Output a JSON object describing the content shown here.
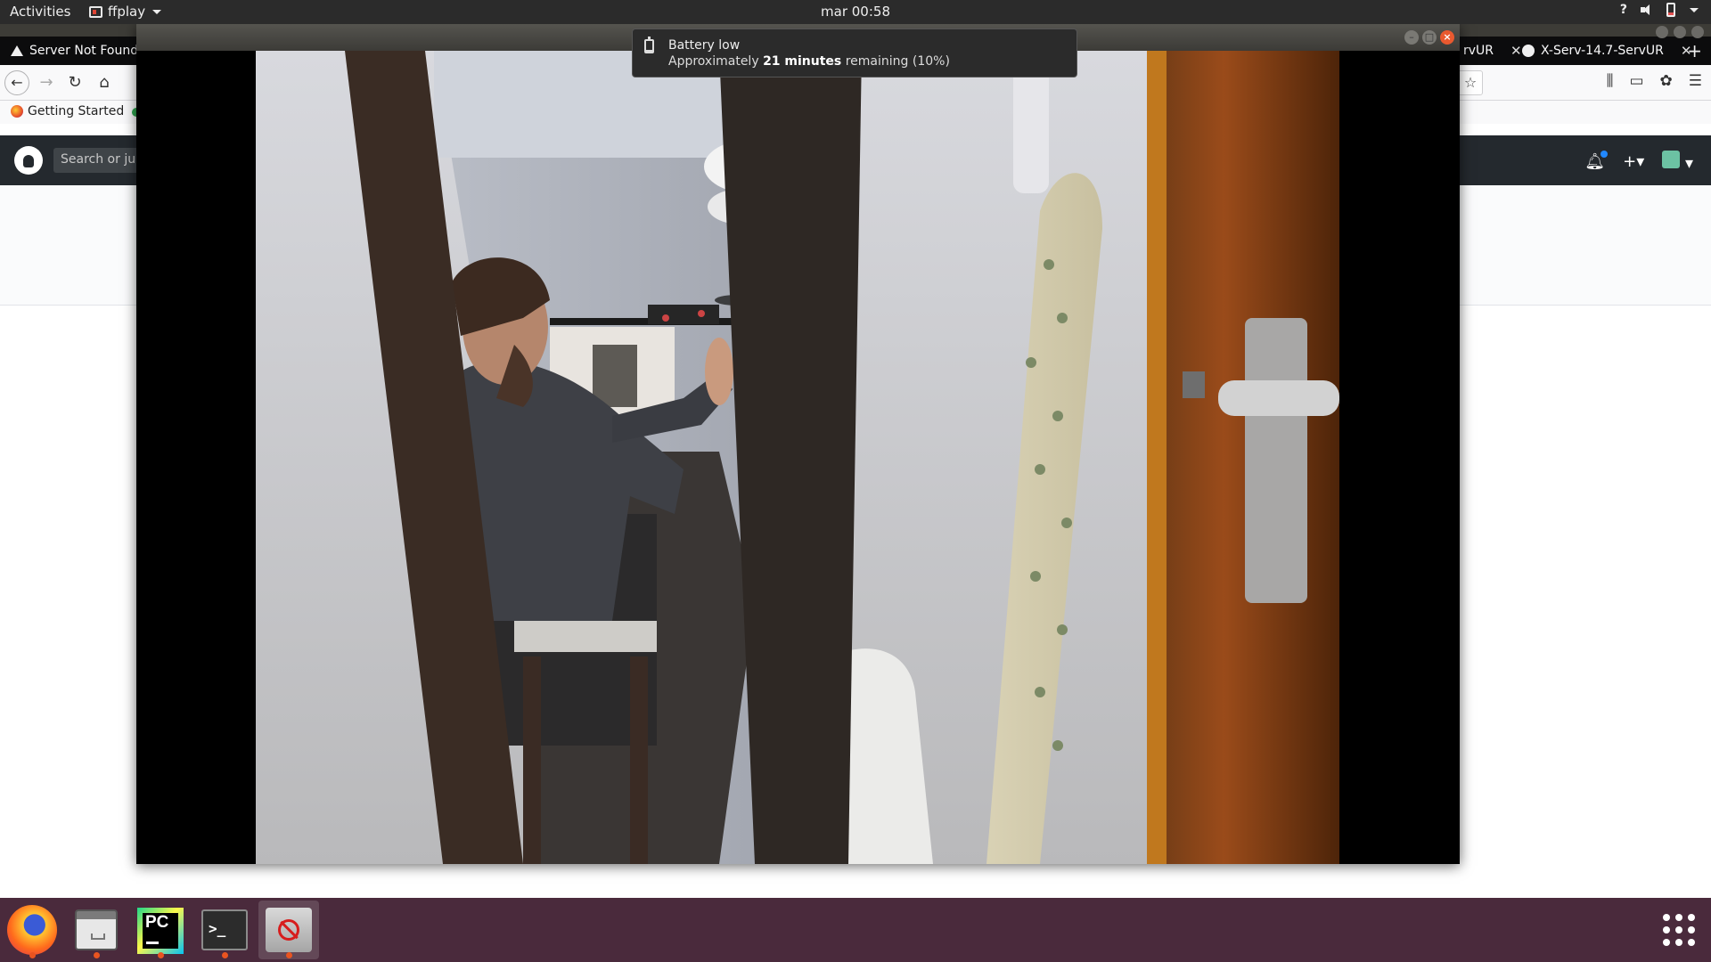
{
  "topbar": {
    "activities": "Activities",
    "app_name": "ffplay",
    "clock": "mar 00:58",
    "help": "?"
  },
  "firefox": {
    "tabs": [
      {
        "label": "Server Not Found",
        "icon": "warning-icon"
      },
      {
        "label": "rvUR",
        "icon": "none"
      },
      {
        "label": "X-Serv-14.7-ServUR",
        "icon": "github-icon"
      }
    ],
    "bookmarks": [
      {
        "label": "Getting Started",
        "icon": "firefox-icon"
      }
    ],
    "github": {
      "search_placeholder": "Search or jum"
    }
  },
  "ffplay_window": {
    "video_frame": "man sitting at desk holding drone, seen through door gap"
  },
  "notification": {
    "title": "Battery low",
    "body_prefix": "Approximately",
    "body_time": "21 minutes",
    "body_suffix": "remaining (10%)"
  },
  "dock": {
    "items": [
      {
        "name": "firefox",
        "icon": "firefox-icon",
        "running": true
      },
      {
        "name": "files",
        "icon": "files-icon",
        "running": true
      },
      {
        "name": "pycharm",
        "icon": "pycharm-icon",
        "label": "PC",
        "running": true
      },
      {
        "name": "terminal",
        "icon": "terminal-icon",
        "label": ">_",
        "running": true
      },
      {
        "name": "ffplay",
        "icon": "ffplay-icon",
        "running": true,
        "active": true
      }
    ]
  },
  "colors": {
    "dock_bg": "#4a2a3c",
    "topbar_bg": "#2b2b2b",
    "running_indicator": "#e95420",
    "close_button": "#e9592f"
  }
}
